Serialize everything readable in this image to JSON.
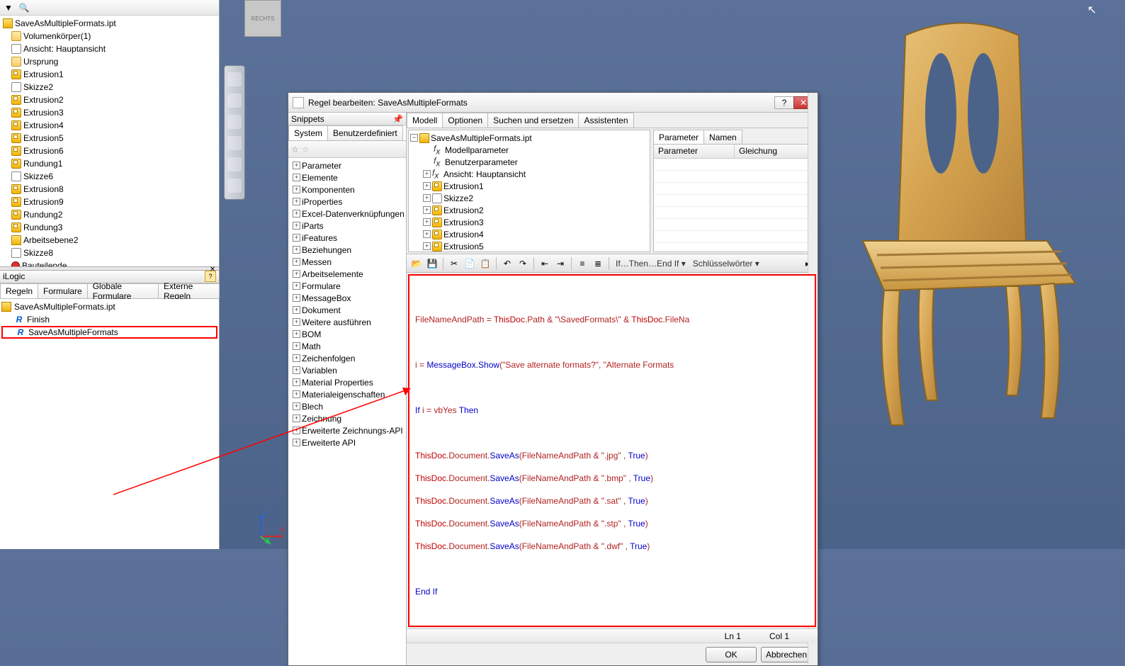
{
  "leftTree": {
    "root": "SaveAsMultipleFormats.ipt",
    "items": [
      {
        "label": "Volumenkörper(1)",
        "icon": "folder",
        "indent": 1
      },
      {
        "label": "Ansicht: Hauptansicht",
        "icon": "view",
        "indent": 1
      },
      {
        "label": "Ursprung",
        "icon": "folder",
        "indent": 1
      },
      {
        "label": "Extrusion1",
        "icon": "ext",
        "indent": 1
      },
      {
        "label": "Skizze2",
        "icon": "skt",
        "indent": 1
      },
      {
        "label": "Extrusion2",
        "icon": "ext",
        "indent": 1
      },
      {
        "label": "Extrusion3",
        "icon": "ext",
        "indent": 1
      },
      {
        "label": "Extrusion4",
        "icon": "ext",
        "indent": 1
      },
      {
        "label": "Extrusion5",
        "icon": "ext",
        "indent": 1
      },
      {
        "label": "Extrusion6",
        "icon": "ext",
        "indent": 1
      },
      {
        "label": "Rundung1",
        "icon": "ext",
        "indent": 1
      },
      {
        "label": "Skizze6",
        "icon": "skt",
        "indent": 1
      },
      {
        "label": "Extrusion8",
        "icon": "ext",
        "indent": 1
      },
      {
        "label": "Extrusion9",
        "icon": "ext",
        "indent": 1
      },
      {
        "label": "Rundung2",
        "icon": "ext",
        "indent": 1
      },
      {
        "label": "Rundung3",
        "icon": "ext",
        "indent": 1
      },
      {
        "label": "Arbeitsebene2",
        "icon": "plane",
        "indent": 1
      },
      {
        "label": "Skizze8",
        "icon": "skt",
        "indent": 1
      },
      {
        "label": "Bauteilende",
        "icon": "end",
        "indent": 1
      }
    ]
  },
  "ilogic": {
    "title": "iLogic",
    "tabs": [
      "Regeln",
      "Formulare",
      "Globale Formulare",
      "Externe Regeln"
    ],
    "root": "SaveAsMultipleFormats.ipt",
    "rules": [
      "Finish",
      "SaveAsMultipleFormats"
    ]
  },
  "dialog": {
    "title": "Regel bearbeiten: SaveAsMultipleFormats",
    "snippets": {
      "title": "Snippets",
      "tabs": [
        "System",
        "Benutzerdefiniert"
      ],
      "items": [
        "Parameter",
        "Elemente",
        "Komponenten",
        "iProperties",
        "Excel-Datenverknüpfungen",
        "iParts",
        "iFeatures",
        "Beziehungen",
        "Messen",
        "Arbeitselemente",
        "Formulare",
        "MessageBox",
        "Dokument",
        "Weitere ausführen",
        "BOM",
        "Math",
        "Zeichenfolgen",
        "Variablen",
        "Material Properties",
        "Materialeigenschaften",
        "Blech",
        "Zeichnung",
        "Erweiterte Zeichnungs-API",
        "Erweiterte API"
      ]
    },
    "topTabs": [
      "Modell",
      "Optionen",
      "Suchen und ersetzen",
      "Assistenten"
    ],
    "modelTree": {
      "root": "SaveAsMultipleFormats.ipt",
      "items": [
        "Modellparameter",
        "Benutzerparameter",
        "Ansicht: Hauptansicht",
        "Extrusion1",
        "Skizze2",
        "Extrusion2",
        "Extrusion3",
        "Extrusion4",
        "Extrusion5"
      ]
    },
    "paramTabs": [
      "Parameter",
      "Namen"
    ],
    "paramHeaders": [
      "Parameter",
      "Gleichung"
    ],
    "editorToolText": "If…Then…End If",
    "keywordsLabel": "Schlüsselwörter",
    "status": {
      "ln": "Ln 1",
      "col": "Col 1"
    },
    "buttons": {
      "ok": "OK",
      "cancel": "Abbrechen"
    }
  },
  "code": {
    "l1a": "FileNameAndPath = ",
    "l1b": "ThisDoc",
    "l1c": ".Path & ",
    "l1d": "\"\\SavedFormats\\\"",
    "l1e": " & ",
    "l1f": "ThisDoc",
    "l1g": ".FileNa",
    "l2a": "i = ",
    "l2b": "MessageBox.Show",
    "l2c": "(",
    "l2d": "\"Save alternate formats?\"",
    "l2e": ", ",
    "l2f": "\"Alternate Formats ",
    "l3a": "If",
    "l3b": " i = vbYes ",
    "l3c": "Then",
    "sa": "ThisDoc",
    "sb": ".Document.",
    "sc": "SaveAs",
    "sd": "(FileNameAndPath & ",
    "e1": "\".jpg\"",
    "e2": "\".bmp\"",
    "e3": "\".sat\"",
    "e4": "\".stp\"",
    "e5": "\".dwf\"",
    "se": " , ",
    "sf": "True",
    "sg": ")",
    "lend": "End If"
  }
}
